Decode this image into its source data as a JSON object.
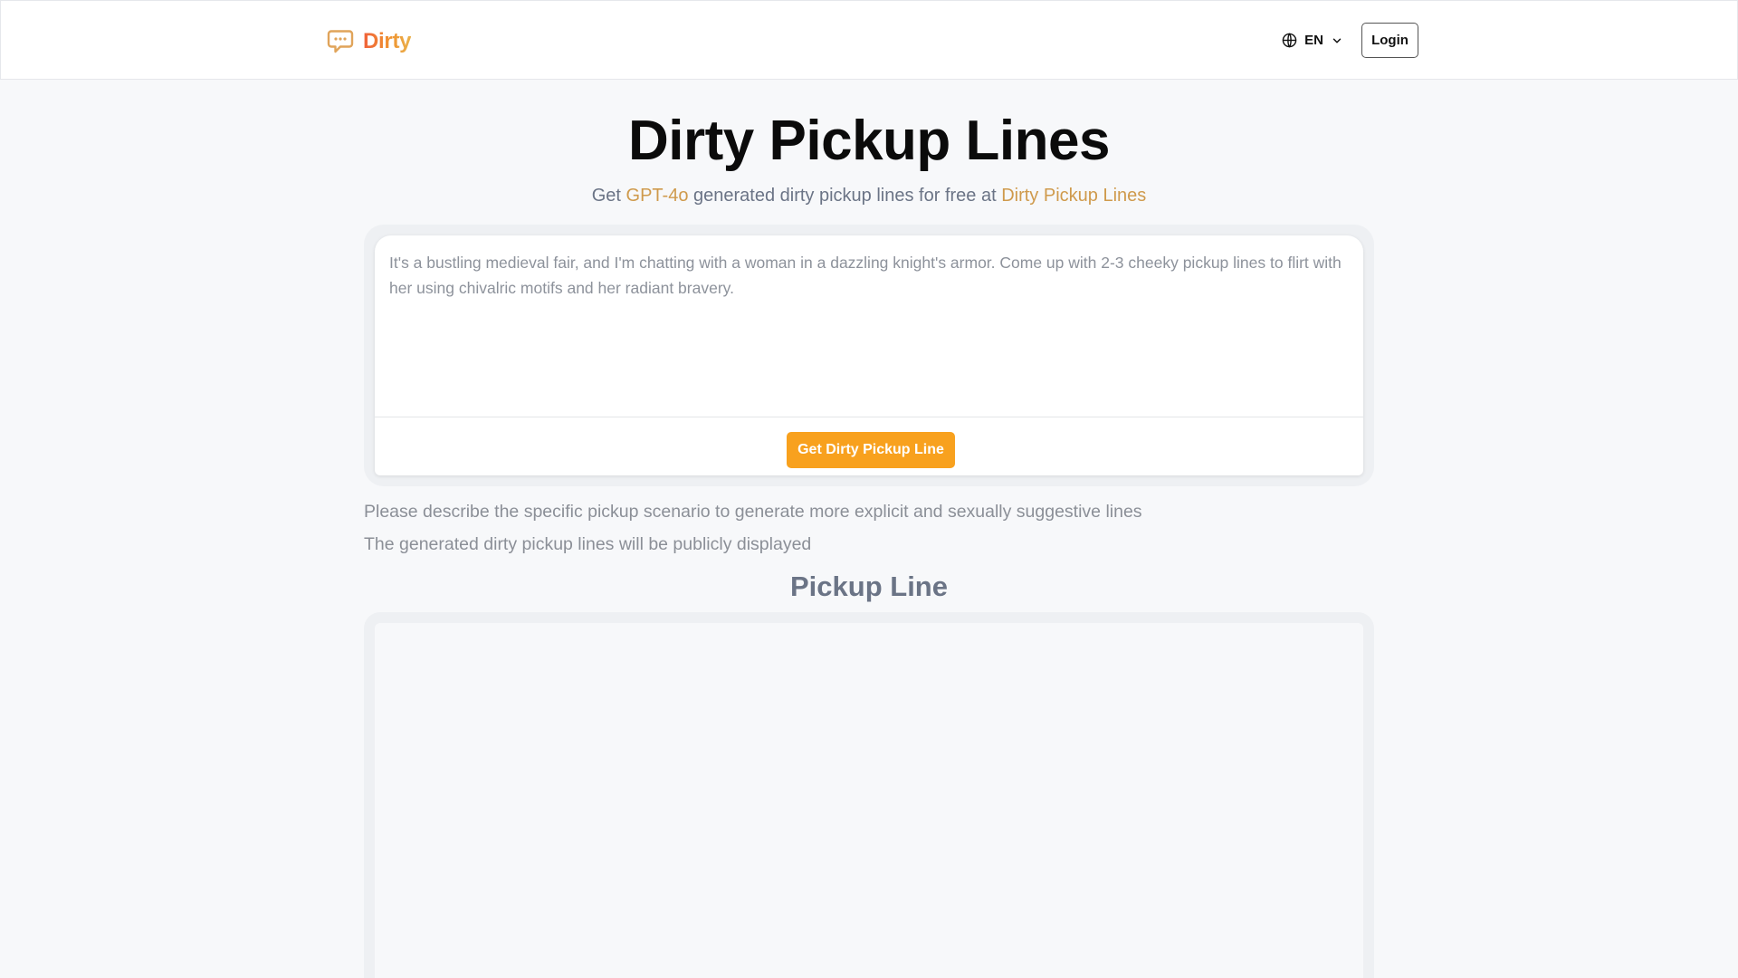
{
  "header": {
    "logo_text": "Dirty",
    "logo_icon": "chat-bubble-icon",
    "language": {
      "icon": "globe-icon",
      "code": "EN",
      "dropdown_icon": "chevron-down-icon"
    },
    "login_label": "Login"
  },
  "hero": {
    "title": "Dirty Pickup Lines",
    "subtitle_prefix": "Get ",
    "subtitle_model": "GPT-4o",
    "subtitle_middle": " generated dirty pickup lines for free at ",
    "subtitle_site": "Dirty Pickup Lines"
  },
  "prompt": {
    "placeholder": "It's a bustling medieval fair, and I'm chatting with a woman in a dazzling knight's armor. Come up with 2-3 cheeky pickup lines to flirt with her using chivalric motifs and her radiant bravery.",
    "value": "",
    "button_label": "Get Dirty Pickup Line"
  },
  "notes": [
    "Please describe the specific pickup scenario to generate more explicit and sexually suggestive lines",
    "The generated dirty pickup lines will be publicly displayed"
  ],
  "output": {
    "title": "Pickup Line",
    "content": ""
  },
  "colors": {
    "accent": "#f8a11e",
    "highlight": "#cf9a4c",
    "logo_gradient_start": "#f0613a",
    "logo_gradient_end": "#e9b04b",
    "muted_text": "#6b7486",
    "background": "#f7f8fa"
  }
}
